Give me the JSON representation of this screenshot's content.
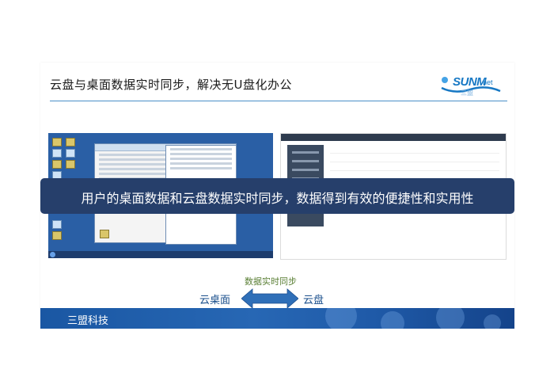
{
  "slide": {
    "title": "云盘与桌面数据实时同步，解决无U盘化办公",
    "logo": {
      "brand": "SUNM",
      "suffix": "net",
      "cn": "三盟"
    },
    "banner": "用户的桌面数据和云盘数据实时同步，数据得到有效的便捷性和实用性",
    "sync": {
      "label": "数据实时同步",
      "left": "云桌面",
      "right": "云盘"
    },
    "footer": "三盟科技"
  },
  "colors": {
    "accent": "#1778c4",
    "banner": "#263f6b",
    "footer": "#1f5aa8",
    "sync_text": "#5a7f35",
    "arrow": "#2f6fb8"
  },
  "icons": [
    "desktop-screenshot",
    "cloud-app-screenshot",
    "double-arrow-icon",
    "sunmnet-logo"
  ]
}
